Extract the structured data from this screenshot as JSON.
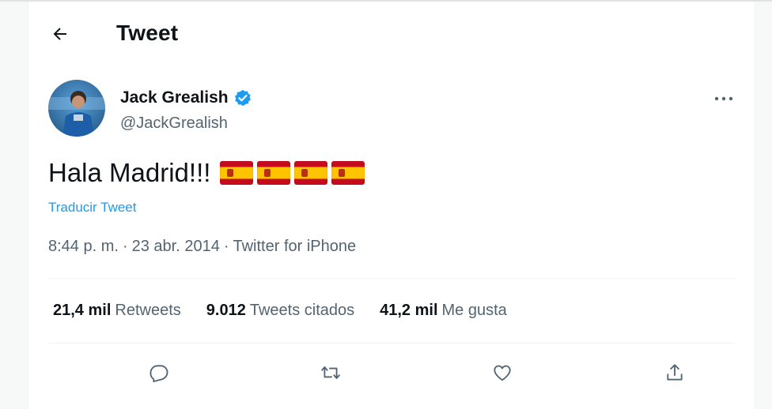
{
  "header": {
    "title": "Tweet"
  },
  "tweet": {
    "author": {
      "name": "Jack Grealish",
      "handle": "@JackGrealish"
    },
    "text": "Hala Madrid!!!",
    "flags": [
      "spain-flag",
      "spain-flag",
      "spain-flag",
      "spain-flag"
    ],
    "translate_label": "Traducir Tweet",
    "time": "8:44 p. m.",
    "separator": "·",
    "date": "23 abr. 2014",
    "source": "Twitter for iPhone"
  },
  "stats": [
    {
      "count": "21,4 mil",
      "label": "Retweets"
    },
    {
      "count": "9.012",
      "label": "Tweets citados"
    },
    {
      "count": "41,2 mil",
      "label": "Me gusta"
    }
  ],
  "actions": [
    "reply-icon",
    "retweet-icon",
    "like-icon",
    "share-icon"
  ],
  "colors": {
    "accent": "#1d9bf0",
    "text": "#0f1419",
    "secondary": "#536471",
    "border": "#eff3f4"
  }
}
